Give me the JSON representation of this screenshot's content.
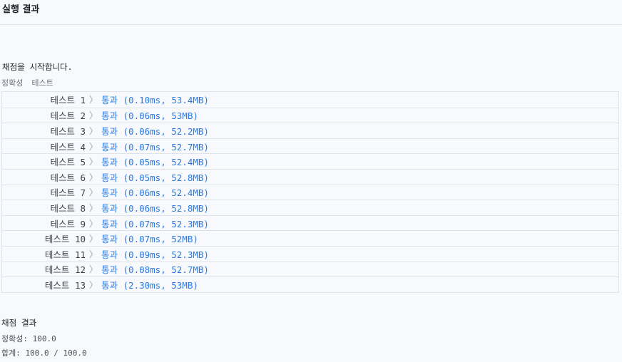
{
  "header": {
    "title": "실행 결과"
  },
  "start_message": "채점을 시작합니다.",
  "section": {
    "label_a": "정확성",
    "label_b": "테스트"
  },
  "tests": [
    {
      "label": "테스트 1",
      "result": "통과 (0.10ms, 53.4MB)"
    },
    {
      "label": "테스트 2",
      "result": "통과 (0.06ms, 53MB)"
    },
    {
      "label": "테스트 3",
      "result": "통과 (0.06ms, 52.2MB)"
    },
    {
      "label": "테스트 4",
      "result": "통과 (0.07ms, 52.7MB)"
    },
    {
      "label": "테스트 5",
      "result": "통과 (0.05ms, 52.4MB)"
    },
    {
      "label": "테스트 6",
      "result": "통과 (0.05ms, 52.8MB)"
    },
    {
      "label": "테스트 7",
      "result": "통과 (0.06ms, 52.4MB)"
    },
    {
      "label": "테스트 8",
      "result": "통과 (0.06ms, 52.8MB)"
    },
    {
      "label": "테스트 9",
      "result": "통과 (0.07ms, 52.3MB)"
    },
    {
      "label": "테스트 10",
      "result": "통과 (0.07ms, 52MB)"
    },
    {
      "label": "테스트 11",
      "result": "통과 (0.09ms, 52.3MB)"
    },
    {
      "label": "테스트 12",
      "result": "통과 (0.08ms, 52.7MB)"
    },
    {
      "label": "테스트 13",
      "result": "통과 (2.30ms, 53MB)"
    }
  ],
  "summary": {
    "title": "채점 결과",
    "accuracy": "정확성: 100.0",
    "total": "합계: 100.0 / 100.0"
  },
  "colors": {
    "pass": "#2a7ae2",
    "border": "#dfe3ea",
    "background": "#f8f9fc"
  },
  "icons": {
    "row_chevron": "chevron-right-icon"
  }
}
